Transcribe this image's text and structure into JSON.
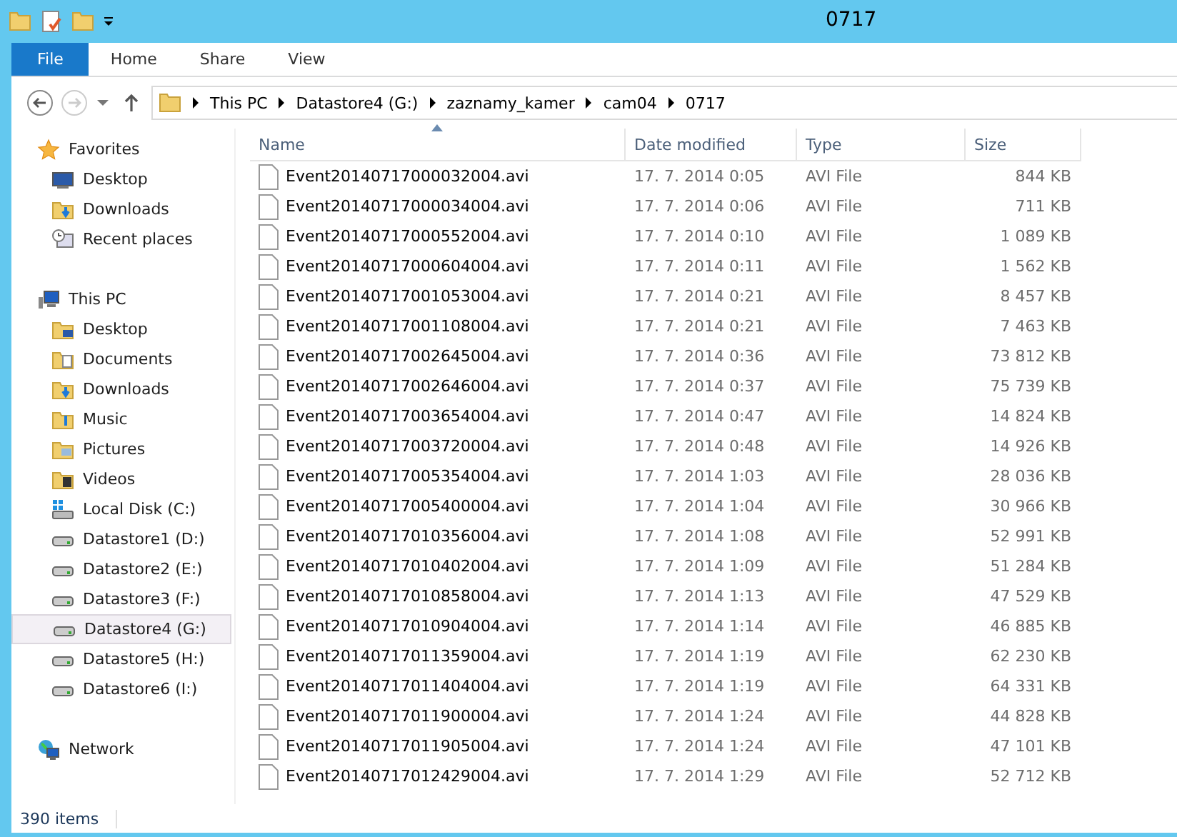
{
  "window": {
    "title": "0717"
  },
  "ribbon_tabs": [
    {
      "label": "File",
      "selected": true
    },
    {
      "label": "Home",
      "selected": false
    },
    {
      "label": "Share",
      "selected": false
    },
    {
      "label": "View",
      "selected": false
    }
  ],
  "breadcrumb": [
    "This PC",
    "Datastore4 (G:)",
    "zaznamy_kamer",
    "cam04",
    "0717"
  ],
  "navigation": [
    {
      "kind": "favorites",
      "label": "Favorites",
      "selected": false,
      "children": [
        {
          "kind": "desktop",
          "label": "Desktop",
          "selected": false
        },
        {
          "kind": "downloads",
          "label": "Downloads",
          "selected": false
        },
        {
          "kind": "recent",
          "label": "Recent places",
          "selected": false
        }
      ]
    },
    {
      "kind": "pc",
      "label": "This PC",
      "selected": false,
      "children": [
        {
          "kind": "folder-desktop",
          "label": "Desktop",
          "selected": false
        },
        {
          "kind": "documents",
          "label": "Documents",
          "selected": false
        },
        {
          "kind": "downloads",
          "label": "Downloads",
          "selected": false
        },
        {
          "kind": "music",
          "label": "Music",
          "selected": false
        },
        {
          "kind": "pictures",
          "label": "Pictures",
          "selected": false
        },
        {
          "kind": "videos",
          "label": "Videos",
          "selected": false
        },
        {
          "kind": "system-drive",
          "label": "Local Disk (C:)",
          "selected": false
        },
        {
          "kind": "drive",
          "label": "Datastore1 (D:)",
          "selected": false
        },
        {
          "kind": "drive",
          "label": "Datastore2 (E:)",
          "selected": false
        },
        {
          "kind": "drive",
          "label": "Datastore3 (F:)",
          "selected": false
        },
        {
          "kind": "drive",
          "label": "Datastore4 (G:)",
          "selected": true
        },
        {
          "kind": "drive",
          "label": "Datastore5 (H:)",
          "selected": false
        },
        {
          "kind": "drive",
          "label": "Datastore6 (I:)",
          "selected": false
        }
      ]
    },
    {
      "kind": "network",
      "label": "Network",
      "selected": false
    }
  ],
  "table": {
    "columns": [
      "Name",
      "Date modified",
      "Type",
      "Size"
    ],
    "rows": [
      [
        "Event20140717000032004.avi",
        "17. 7. 2014 0:05",
        "AVI File",
        "844 KB"
      ],
      [
        "Event20140717000034004.avi",
        "17. 7. 2014 0:06",
        "AVI File",
        "711 KB"
      ],
      [
        "Event20140717000552004.avi",
        "17. 7. 2014 0:10",
        "AVI File",
        "1 089 KB"
      ],
      [
        "Event20140717000604004.avi",
        "17. 7. 2014 0:11",
        "AVI File",
        "1 562 KB"
      ],
      [
        "Event20140717001053004.avi",
        "17. 7. 2014 0:21",
        "AVI File",
        "8 457 KB"
      ],
      [
        "Event20140717001108004.avi",
        "17. 7. 2014 0:21",
        "AVI File",
        "7 463 KB"
      ],
      [
        "Event20140717002645004.avi",
        "17. 7. 2014 0:36",
        "AVI File",
        "73 812 KB"
      ],
      [
        "Event20140717002646004.avi",
        "17. 7. 2014 0:37",
        "AVI File",
        "75 739 KB"
      ],
      [
        "Event20140717003654004.avi",
        "17. 7. 2014 0:47",
        "AVI File",
        "14 824 KB"
      ],
      [
        "Event20140717003720004.avi",
        "17. 7. 2014 0:48",
        "AVI File",
        "14 926 KB"
      ],
      [
        "Event20140717005354004.avi",
        "17. 7. 2014 1:03",
        "AVI File",
        "28 036 KB"
      ],
      [
        "Event20140717005400004.avi",
        "17. 7. 2014 1:04",
        "AVI File",
        "30 966 KB"
      ],
      [
        "Event20140717010356004.avi",
        "17. 7. 2014 1:08",
        "AVI File",
        "52 991 KB"
      ],
      [
        "Event20140717010402004.avi",
        "17. 7. 2014 1:09",
        "AVI File",
        "51 284 KB"
      ],
      [
        "Event20140717010858004.avi",
        "17. 7. 2014 1:13",
        "AVI File",
        "47 529 KB"
      ],
      [
        "Event20140717010904004.avi",
        "17. 7. 2014 1:14",
        "AVI File",
        "46 885 KB"
      ],
      [
        "Event20140717011359004.avi",
        "17. 7. 2014 1:19",
        "AVI File",
        "62 230 KB"
      ],
      [
        "Event20140717011404004.avi",
        "17. 7. 2014 1:19",
        "AVI File",
        "64 331 KB"
      ],
      [
        "Event20140717011900004.avi",
        "17. 7. 2014 1:24",
        "AVI File",
        "44 828 KB"
      ],
      [
        "Event20140717011905004.avi",
        "17. 7. 2014 1:24",
        "AVI File",
        "47 101 KB"
      ],
      [
        "Event20140717012429004.avi",
        "17. 7. 2014 1:29",
        "AVI File",
        "52 712 KB"
      ]
    ]
  },
  "status_bar": {
    "item_count": "390 items"
  }
}
